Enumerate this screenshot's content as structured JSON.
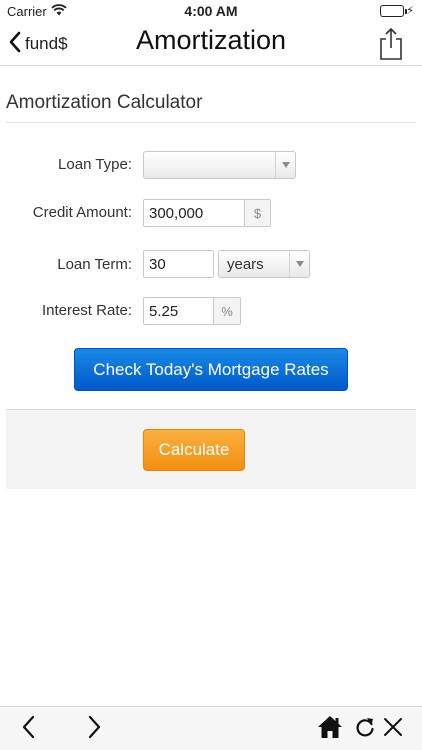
{
  "status_bar": {
    "carrier": "Carrier",
    "time": "4:00 AM",
    "icons": [
      "wifi-icon",
      "battery-icon",
      "charging-bolt-icon"
    ]
  },
  "nav": {
    "back_label": "fund$",
    "title": "Amortization",
    "icons": [
      "chevron-left-icon",
      "share-icon"
    ]
  },
  "calculator": {
    "title": "Amortization Calculator",
    "loan_type": {
      "label": "Loan Type:",
      "value": ""
    },
    "credit_amount": {
      "label": "Credit Amount:",
      "value": "300,000",
      "addon": "$"
    },
    "loan_term": {
      "label": "Loan Term:",
      "value": "30",
      "unit": "years"
    },
    "interest_rate": {
      "label": "Interest Rate:",
      "value": "5.25",
      "addon": "%"
    },
    "rates_button": "Check Today's Mortgage Rates",
    "calculate_button": "Calculate"
  },
  "toolbar": {
    "icons": [
      "back-arrow-icon",
      "forward-arrow-icon",
      "home-icon",
      "reload-icon",
      "close-icon"
    ]
  },
  "colors": {
    "rates_button": "#0a6fd8",
    "calculate_button": "#f7a028",
    "panel_background": "#f4f4f4"
  }
}
